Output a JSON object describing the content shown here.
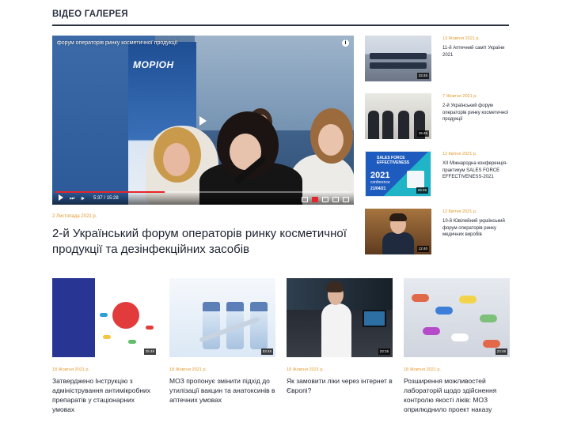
{
  "section": {
    "title": "ВІДЕО ГАЛЕРЕЯ"
  },
  "colors": {
    "accent_date": "#e39a2d",
    "text": "#1d2330",
    "rule": "#2b3140",
    "progress": "#e5252a"
  },
  "main_video": {
    "player_title": "форум операторів ринку косметичної продукції",
    "info_icon_text": "i",
    "time": "5:37 / 15:28",
    "progress_fraction": 0.37,
    "logo_text": "МОРІОН",
    "date": "2 Листопада 2021 р.",
    "title": "2-й Український форум операторів ринку косметичної продукції та дезінфекційних засобів"
  },
  "side_videos": [
    {
      "date": "13 Жовтня 2021 р.",
      "title": "11-й Аптечний саміт України 2021",
      "duration": "33:48",
      "icon": "conference-hall-thumbnail"
    },
    {
      "date": "7 Жовтня 2021 р.",
      "title": "2-й Український форум операторів ринку косметичної продукції",
      "duration": "15:45",
      "icon": "panel-speakers-thumbnail"
    },
    {
      "date": "12 Квітня 2021 р.",
      "title": "XII Міжнародна конференція-практикум SALES FORCE EFFECTIVENESS-2021",
      "duration": "29:45",
      "icon": "sales-force-thumbnail",
      "thumb_label": "SALES FORCE EFFECTIVENESS",
      "thumb_year": "2021",
      "thumb_conf": "conference",
      "thumb_date": "21/04/21"
    },
    {
      "date": "12 Квітня 2021 р.",
      "title": "10-й Ювілейний український форум операторів ринку медичних виробів",
      "duration": "12:40",
      "icon": "speaker-portrait-thumbnail"
    }
  ],
  "grid_videos": [
    {
      "date": "18 Жовтня 2021 р.",
      "title": "Затверджено Інструкцію з адміністрування антимікробних препаратів у стаціонарних умовах",
      "duration": "25:48",
      "icon": "antimicrobial-guide-thumbnail"
    },
    {
      "date": "18 Жовтня 2021 р.",
      "title": "МОЗ пропонує змінити підхід до утилізації вакцин та анатоксинів в аптечних умовах",
      "duration": "03:48",
      "icon": "vaccine-vials-thumbnail"
    },
    {
      "date": "18 Жовтня 2021 р.",
      "title": "Як замовити ліки через інтернет в Європі?",
      "duration": "23:15",
      "icon": "pharmacist-screen-thumbnail"
    },
    {
      "date": "18 Жовтня 2021 р.",
      "title": "Розширення можливостей лабораторій щодо здійснення контролю якості ліків: МОЗ оприлюднило проект наказу",
      "duration": "23:48",
      "icon": "pills-capsules-thumbnail"
    }
  ]
}
